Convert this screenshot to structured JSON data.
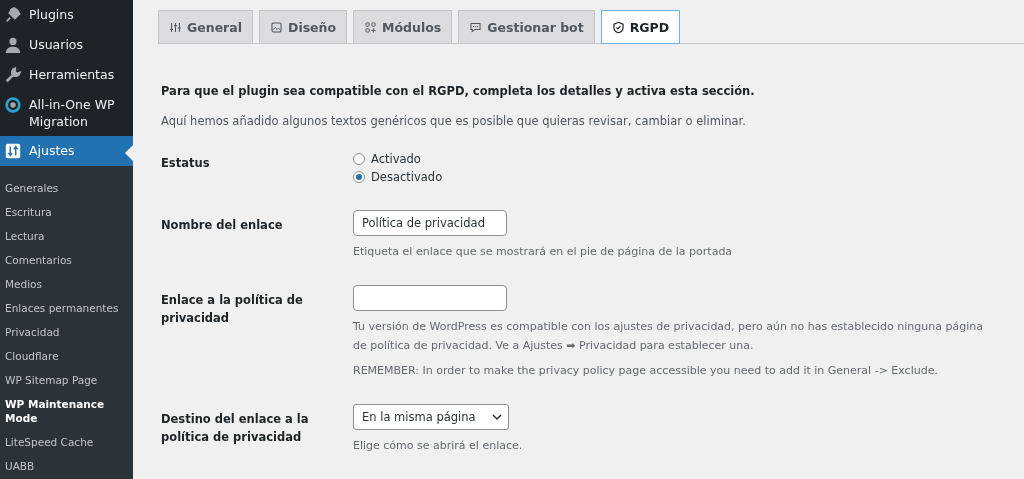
{
  "sidebar": {
    "menu": [
      {
        "label": "Plugins",
        "selected": false
      },
      {
        "label": "Usuarios",
        "selected": false
      },
      {
        "label": "Herramientas",
        "selected": false
      },
      {
        "label": "All-in-One WP Migration",
        "selected": false
      },
      {
        "label": "Ajustes",
        "selected": true
      }
    ],
    "submenu": [
      {
        "label": "Generales",
        "selected": false
      },
      {
        "label": "Escritura",
        "selected": false
      },
      {
        "label": "Lectura",
        "selected": false
      },
      {
        "label": "Comentarios",
        "selected": false
      },
      {
        "label": "Medios",
        "selected": false
      },
      {
        "label": "Enlaces permanentes",
        "selected": false
      },
      {
        "label": "Privacidad",
        "selected": false
      },
      {
        "label": "Cloudflare",
        "selected": false
      },
      {
        "label": "WP Sitemap Page",
        "selected": false
      },
      {
        "label": "WP Maintenance Mode",
        "selected": true
      },
      {
        "label": "LiteSpeed Cache",
        "selected": false
      },
      {
        "label": "UABB",
        "selected": false
      }
    ]
  },
  "tabs": [
    {
      "label": "General",
      "selected": false
    },
    {
      "label": "Diseño",
      "selected": false
    },
    {
      "label": "Módulos",
      "selected": false
    },
    {
      "label": "Gestionar bot",
      "selected": false
    },
    {
      "label": "RGPD",
      "selected": true
    }
  ],
  "intro": "Para que el plugin sea compatible con el RGPD, completa los detalles y activa esta sección.",
  "note": "Aquí hemos añadido algunos textos genéricos que es posible que quieras revisar, cambiar o eliminar.",
  "fields": [
    {
      "kind": "radio",
      "label": "Estatus",
      "options": [
        {
          "label": "Activado",
          "selected": false
        },
        {
          "label": "Desactivado",
          "selected": true
        }
      ]
    },
    {
      "kind": "text",
      "label": "Nombre del enlace",
      "value": "Política de privacidad",
      "help": [
        "Etiqueta el enlace que se mostrará en el pie de página de la portada"
      ]
    },
    {
      "kind": "text",
      "label": "Enlace a la política de privacidad",
      "help": [
        "Tu versión de WordPress es compatible con los ajustes de privacidad, pero aún no has establecido ninguna página de política de privacidad. Ve a Ajustes ➡ Privacidad para establecer una.",
        "REMEMBER: In order to make the privacy policy page accessible you need to add it in General -> Exclude."
      ]
    },
    {
      "kind": "select",
      "label": "Destino del enlace a la política de privacidad",
      "value": "En la misma página",
      "help": [
        "Elige cómo se abrirá el enlace."
      ]
    }
  ]
}
